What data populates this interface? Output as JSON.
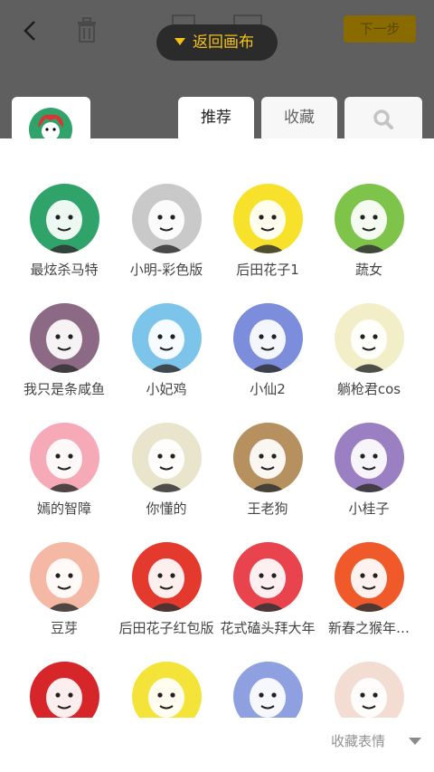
{
  "toolbar": {
    "next_label": "下一步",
    "back_to_canvas_label": "返回画布"
  },
  "tabs": [
    {
      "label": "推荐",
      "active": true
    },
    {
      "label": "收藏",
      "active": false
    },
    {
      "icon": "search-icon",
      "active": false
    }
  ],
  "stickers": [
    {
      "name": "最炫杀马特",
      "bg": "#2fa36a"
    },
    {
      "name": "小明-彩色版",
      "bg": "#c9c9c9"
    },
    {
      "name": "后田花子1",
      "bg": "#f7e12b"
    },
    {
      "name": "蔬女",
      "bg": "#7fc44a"
    },
    {
      "name": "我只是条咸鱼",
      "bg": "#8c6a86"
    },
    {
      "name": "小妃鸡",
      "bg": "#7dc4ea"
    },
    {
      "name": "小仙2",
      "bg": "#7b8ddb"
    },
    {
      "name": "躺枪君cos",
      "bg": "#f2efc8"
    },
    {
      "name": "嫣的智障",
      "bg": "#f6a9b6"
    },
    {
      "name": "你懂的",
      "bg": "#e9e4cc"
    },
    {
      "name": "王老狗",
      "bg": "#b79060"
    },
    {
      "name": "小桂子",
      "bg": "#9b7fc3"
    },
    {
      "name": "豆芽",
      "bg": "#f5b8a4"
    },
    {
      "name": "后田花子红包版",
      "bg": "#e43a2e"
    },
    {
      "name": "花式磕头拜大年",
      "bg": "#e9434d"
    },
    {
      "name": "新春之猴年…",
      "bg": "#f05a2a"
    },
    {
      "name": "",
      "bg": "#d6262a"
    },
    {
      "name": "",
      "bg": "#f4e43a"
    },
    {
      "name": "",
      "bg": "#8ea0e0"
    },
    {
      "name": "",
      "bg": "#f3ddd2"
    }
  ],
  "collect_label": "收藏表情",
  "colors": {
    "accent": "#f2c21b",
    "topbar": "#5f5f5f"
  }
}
